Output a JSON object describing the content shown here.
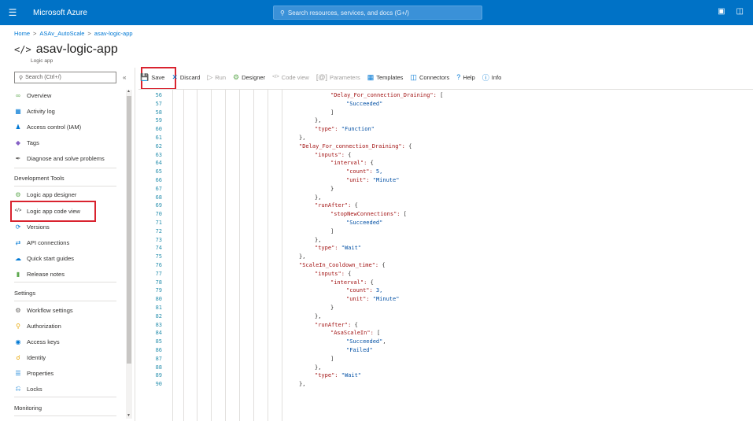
{
  "topbar": {
    "menu_icon": "hamburger-icon",
    "brand": "Microsoft Azure",
    "search_placeholder": "Search resources, services, and docs (G+/)",
    "icons": [
      "cloud-shell-icon",
      "directory-filter-icon"
    ]
  },
  "breadcrumb": [
    "Home",
    "ASAv_AutoScale",
    "asav-logic-app"
  ],
  "page": {
    "icon": "</>",
    "title": "asav-logic-app",
    "subtitle": "Logic app"
  },
  "sidebar": {
    "search_placeholder": "Search (Ctrl+/)",
    "collapse_glyph": "«",
    "items": [
      {
        "label": "Overview",
        "icon": "overview-icon"
      },
      {
        "label": "Activity log",
        "icon": "activity-log-icon"
      },
      {
        "label": "Access control (IAM)",
        "icon": "iam-icon"
      },
      {
        "label": "Tags",
        "icon": "tag-icon"
      },
      {
        "label": "Diagnose and solve problems",
        "icon": "wrench-icon"
      }
    ],
    "section_dev": "Development Tools",
    "dev_items": [
      {
        "label": "Logic app designer",
        "icon": "designer-icon"
      },
      {
        "label": "Logic app code view",
        "icon": "code-icon"
      },
      {
        "label": "Versions",
        "icon": "versions-icon"
      },
      {
        "label": "API connections",
        "icon": "api-connections-icon"
      },
      {
        "label": "Quick start guides",
        "icon": "quickstart-icon"
      },
      {
        "label": "Release notes",
        "icon": "release-notes-icon"
      }
    ],
    "section_settings": "Settings",
    "settings_items": [
      {
        "label": "Workflow settings",
        "icon": "gear-icon"
      },
      {
        "label": "Authorization",
        "icon": "key-icon"
      },
      {
        "label": "Access keys",
        "icon": "access-keys-icon"
      },
      {
        "label": "Identity",
        "icon": "identity-icon"
      },
      {
        "label": "Properties",
        "icon": "properties-icon"
      },
      {
        "label": "Locks",
        "icon": "lock-icon"
      }
    ],
    "section_monitoring": "Monitoring"
  },
  "toolbar": {
    "save": "Save",
    "discard": "Discard",
    "run": "Run",
    "designer": "Designer",
    "code_view": "Code view",
    "parameters": "Parameters",
    "templates": "Templates",
    "connectors": "Connectors",
    "help": "Help",
    "info": "Info"
  },
  "code_lines": [
    {
      "n": "56",
      "indent": 0,
      "t": "\"Delay_For_connection_Draining\": ["
    },
    {
      "n": "57",
      "indent": 1,
      "t": "\"Succeeded\""
    },
    {
      "n": "58",
      "indent": 0,
      "t": "]"
    },
    {
      "n": "59",
      "indent": -1,
      "t": "},"
    },
    {
      "n": "60",
      "indent": -1,
      "t": "\"type\": \"Function\""
    },
    {
      "n": "61",
      "indent": -2,
      "t": "},"
    },
    {
      "n": "62",
      "indent": -2,
      "t": "\"Delay_For_connection_Draining\": {"
    },
    {
      "n": "63",
      "indent": -1,
      "t": "\"inputs\": {"
    },
    {
      "n": "64",
      "indent": 0,
      "t": "\"interval\": {"
    },
    {
      "n": "65",
      "indent": 1,
      "t": "\"count\": 5,"
    },
    {
      "n": "66",
      "indent": 1,
      "t": "\"unit\": \"Minute\""
    },
    {
      "n": "67",
      "indent": 0,
      "t": "}"
    },
    {
      "n": "68",
      "indent": -1,
      "t": "},"
    },
    {
      "n": "69",
      "indent": -1,
      "t": "\"runAfter\": {"
    },
    {
      "n": "70",
      "indent": 0,
      "t": "\"stopNewConnections\": ["
    },
    {
      "n": "71",
      "indent": 1,
      "t": "\"Succeeded\""
    },
    {
      "n": "72",
      "indent": 0,
      "t": "]"
    },
    {
      "n": "73",
      "indent": -1,
      "t": "},"
    },
    {
      "n": "74",
      "indent": -1,
      "t": "\"type\": \"Wait\""
    },
    {
      "n": "75",
      "indent": -2,
      "t": "},"
    },
    {
      "n": "76",
      "indent": -2,
      "t": "\"ScaleIn_Cooldown_time\": {"
    },
    {
      "n": "77",
      "indent": -1,
      "t": "\"inputs\": {"
    },
    {
      "n": "78",
      "indent": 0,
      "t": "\"interval\": {"
    },
    {
      "n": "79",
      "indent": 1,
      "t": "\"count\": 3,"
    },
    {
      "n": "80",
      "indent": 1,
      "t": "\"unit\": \"Minute\""
    },
    {
      "n": "81",
      "indent": 0,
      "t": "}"
    },
    {
      "n": "82",
      "indent": -1,
      "t": "},"
    },
    {
      "n": "83",
      "indent": -1,
      "t": "\"runAfter\": {"
    },
    {
      "n": "84",
      "indent": 0,
      "t": "\"AsaScaleIn\": ["
    },
    {
      "n": "85",
      "indent": 1,
      "t": "\"Succeeded\","
    },
    {
      "n": "86",
      "indent": 1,
      "t": "\"Failed\""
    },
    {
      "n": "87",
      "indent": 0,
      "t": "]"
    },
    {
      "n": "88",
      "indent": -1,
      "t": "},"
    },
    {
      "n": "89",
      "indent": -1,
      "t": "\"type\": \"Wait\""
    },
    {
      "n": "90",
      "indent": -2,
      "t": "},"
    }
  ]
}
